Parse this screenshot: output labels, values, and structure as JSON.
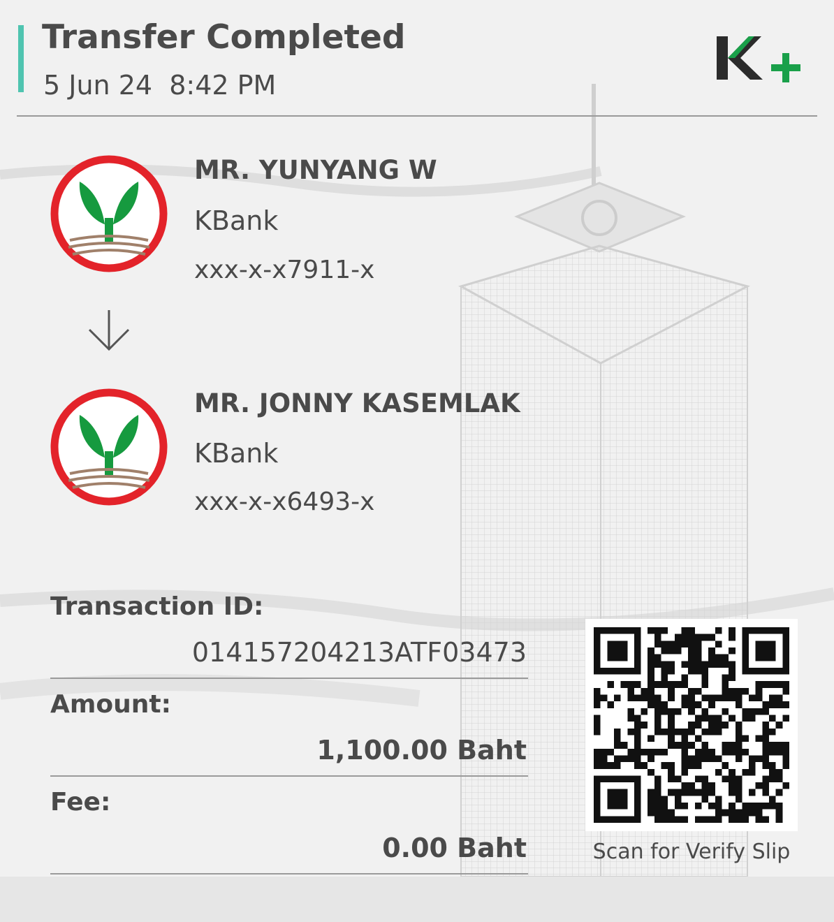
{
  "header": {
    "title": "Transfer Completed",
    "datetime": "5 Jun 24  8:42 PM",
    "brand_logo": "K+",
    "brand_green": "#1aa04a",
    "accent_color": "#4fc4b0"
  },
  "sender": {
    "name": "MR. YUNYANG W",
    "bank": "KBank",
    "account": "xxx-x-x7911-x",
    "logo_icon": "kbank-logo"
  },
  "receiver": {
    "name": "MR. JONNY KASEMLAK",
    "bank": "KBank",
    "account": "xxx-x-x6493-x",
    "logo_icon": "kbank-logo"
  },
  "details": {
    "transaction_id_label": "Transaction ID:",
    "transaction_id": "014157204213ATF03473",
    "amount_label": "Amount:",
    "amount": "1,100.00 Baht",
    "fee_label": "Fee:",
    "fee": "0.00 Baht"
  },
  "qr": {
    "caption": "Scan for Verify Slip",
    "icon": "qr-code"
  }
}
